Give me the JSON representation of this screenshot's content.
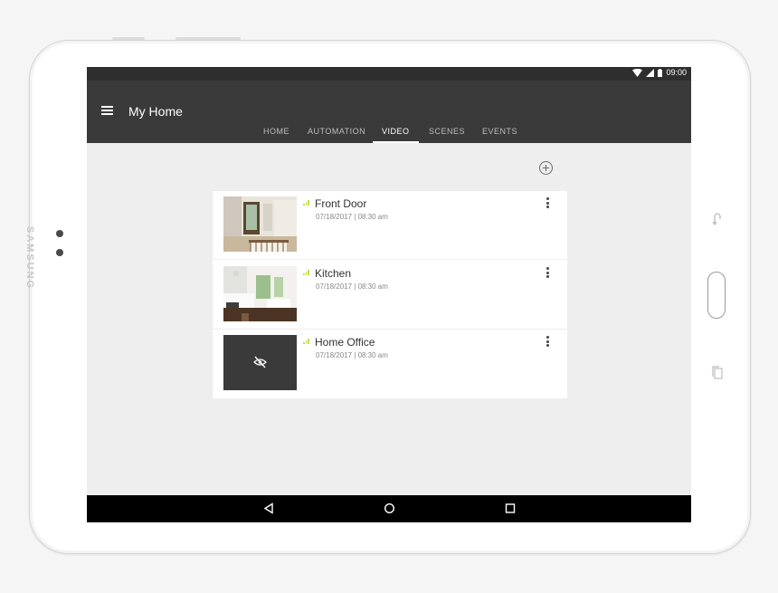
{
  "device": {
    "brand": "SAMSUNG"
  },
  "status_bar": {
    "time": "09:00"
  },
  "app": {
    "title": "My Home"
  },
  "tabs": [
    {
      "label": "HOME",
      "active": false
    },
    {
      "label": "AUTOMATION",
      "active": false
    },
    {
      "label": "VIDEO",
      "active": true
    },
    {
      "label": "SCENES",
      "active": false
    },
    {
      "label": "EVENTS",
      "active": false
    }
  ],
  "cameras": [
    {
      "name": "Front Door",
      "timestamp": "07/18/2017 | 08:30 am",
      "thumbnail": "front-door-snapshot"
    },
    {
      "name": "Kitchen",
      "timestamp": "07/18/2017 | 08:30 am",
      "thumbnail": "kitchen-snapshot"
    },
    {
      "name": "Home Office",
      "timestamp": "07/18/2017 | 08:30 am",
      "thumbnail": "privacy-hidden"
    }
  ],
  "icons": {
    "menu": "hamburger-menu-icon",
    "add": "add-circle-icon",
    "more": "more-vert-icon",
    "signal": "signal-strength-icon",
    "hidden": "eye-off-icon",
    "back": "back-triangle-icon",
    "home": "home-circle-icon",
    "recents": "recents-square-icon"
  },
  "colors": {
    "app_bar": "#3a3a3a",
    "status_bar": "#2e2e2e",
    "background": "#eeeeee",
    "signal_accent": "#c8d65a",
    "hidden_thumbnail": "#3a3a3a"
  }
}
